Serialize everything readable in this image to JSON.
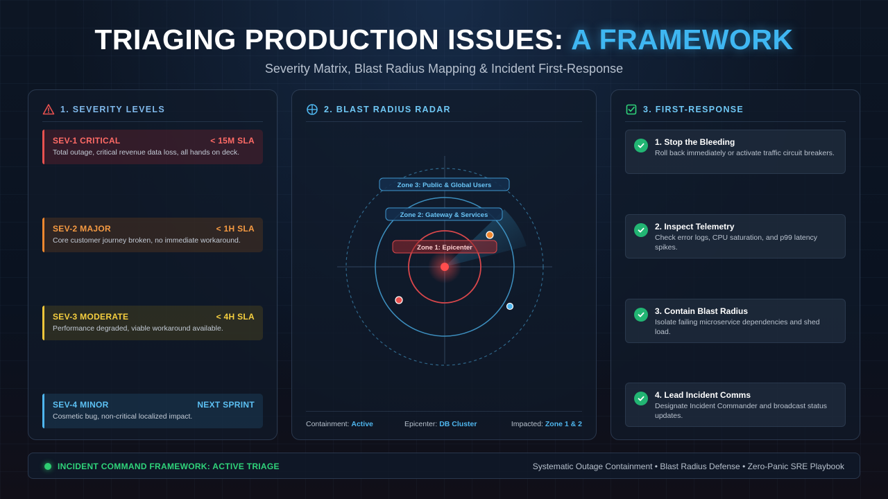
{
  "title": {
    "main": "TRIAGING PRODUCTION ISSUES:",
    "accent": "A FRAMEWORK"
  },
  "subtitle": "Severity Matrix, Blast Radius Mapping & Incident First-Response",
  "severity_panel": {
    "heading": "1. SEVERITY LEVELS",
    "icon": "warning-triangle-icon",
    "levels": [
      {
        "name": "SEV-1 CRITICAL",
        "sla": "< 15M SLA",
        "desc": "Total outage, critical revenue data loss, all hands on deck.",
        "color": "#e8514f"
      },
      {
        "name": "SEV-2 MAJOR",
        "sla": "< 1H SLA",
        "desc": "Core customer journey broken, no immediate workaround.",
        "color": "#f0882f"
      },
      {
        "name": "SEV-3 MODERATE",
        "sla": "< 4H SLA",
        "desc": "Performance degraded, viable workaround available.",
        "color": "#f1c63a"
      },
      {
        "name": "SEV-4 MINOR",
        "sla": "NEXT SPRINT",
        "desc": "Cosmetic bug, non-critical localized impact.",
        "color": "#4fb6ee"
      }
    ]
  },
  "radar_panel": {
    "heading": "2. BLAST RADIUS RADAR",
    "icon": "crosshair-icon",
    "zones": [
      "Zone 3: Public & Global Users",
      "Zone 2: Gateway & Services",
      "Zone 1: Epicenter"
    ],
    "footer": {
      "containment_label": "Containment:",
      "containment_value": "Active",
      "epicenter_label": "Epicenter:",
      "epicenter_value": "DB Cluster",
      "impacted_label": "Impacted:",
      "impacted_value": "Zone 1 & 2"
    }
  },
  "response_panel": {
    "heading": "3. FIRST-RESPONSE",
    "icon": "checkbox-icon",
    "steps": [
      {
        "title": "1. Stop the Bleeding",
        "desc": "Roll back immediately or activate traffic circuit breakers."
      },
      {
        "title": "2. Inspect Telemetry",
        "desc": "Check error logs, CPU saturation, and p99 latency spikes."
      },
      {
        "title": "3. Contain Blast Radius",
        "desc": "Isolate failing microservice dependencies and shed load."
      },
      {
        "title": "4. Lead Incident Comms",
        "desc": "Designate Incident Commander and broadcast status updates."
      }
    ]
  },
  "status_bar": {
    "text": "INCIDENT COMMAND FRAMEWORK: ACTIVE TRIAGE",
    "tagline": "Systematic Outage Containment • Blast Radius Defense • Zero-Panic SRE Playbook"
  },
  "colors": {
    "accent": "#3fb7f2",
    "critical": "#e8514f",
    "success": "#22b573"
  }
}
